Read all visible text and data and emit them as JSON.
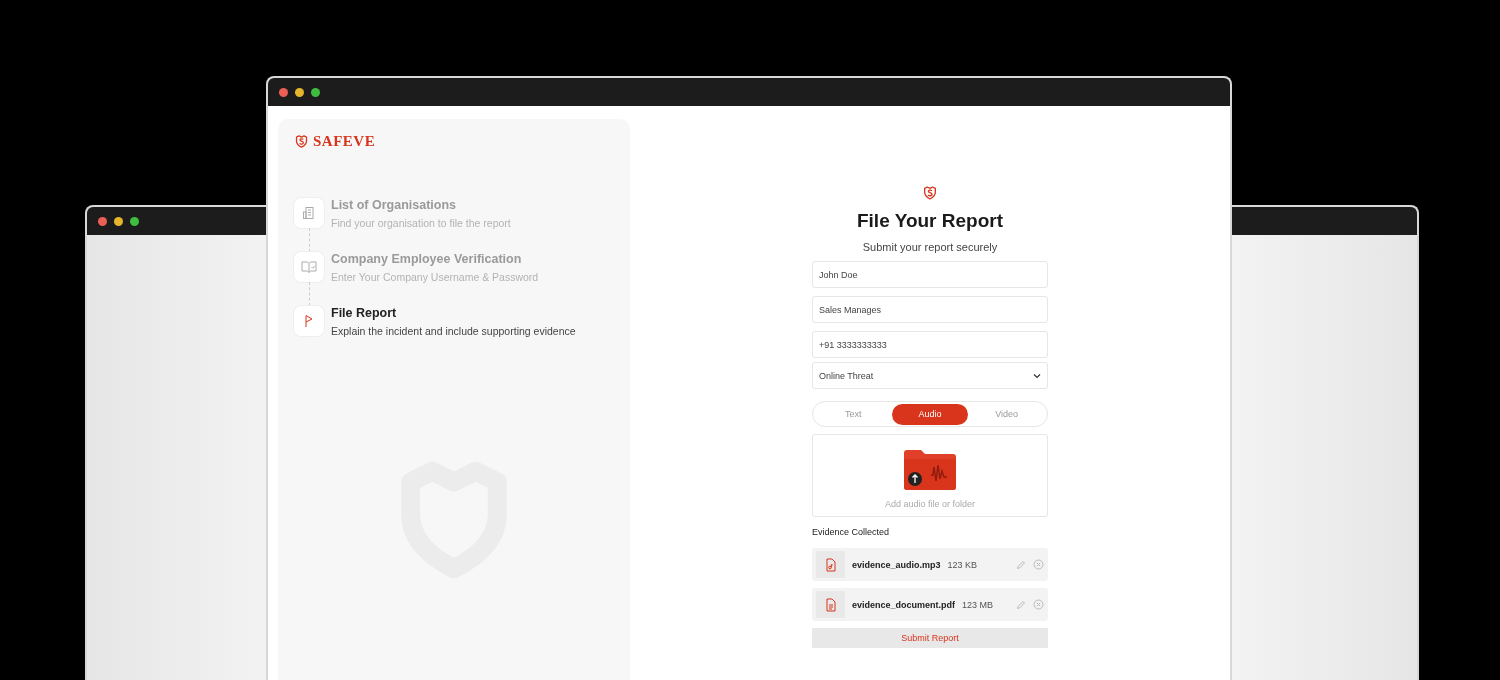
{
  "brand": {
    "name": "SAFEVE"
  },
  "steps": [
    {
      "kind": "organisations",
      "title": "List of Organisations",
      "description": "Find your organisation to file the report",
      "active": false
    },
    {
      "kind": "verification",
      "title": "Company Employee Verification",
      "description": "Enter Your Company Username & Password",
      "active": false
    },
    {
      "kind": "report",
      "title": "File Report",
      "description": "Explain the incident and include supporting evidence",
      "active": true
    }
  ],
  "form": {
    "title": "File Your Report",
    "subtitle": "Submit your report securely",
    "fields": [
      {
        "kind": "text",
        "value": "John Doe"
      },
      {
        "kind": "text",
        "value": "Sales Manages"
      },
      {
        "kind": "text",
        "value": "+91 3333333333"
      },
      {
        "kind": "select",
        "value": "Online Threat"
      }
    ],
    "tabs": [
      {
        "label": "Text",
        "selected": false
      },
      {
        "label": "Audio",
        "selected": true
      },
      {
        "label": "Video",
        "selected": false
      }
    ],
    "upload": {
      "hint": "Add audio file or folder"
    },
    "evidence_heading": "Evidence Collected",
    "evidence": [
      {
        "kind": "audio",
        "name": "evidence_audio.mp3",
        "size": "123 KB"
      },
      {
        "kind": "document",
        "name": "evidence_document.pdf",
        "size": "123 MB"
      }
    ],
    "submit": "Submit Report"
  }
}
